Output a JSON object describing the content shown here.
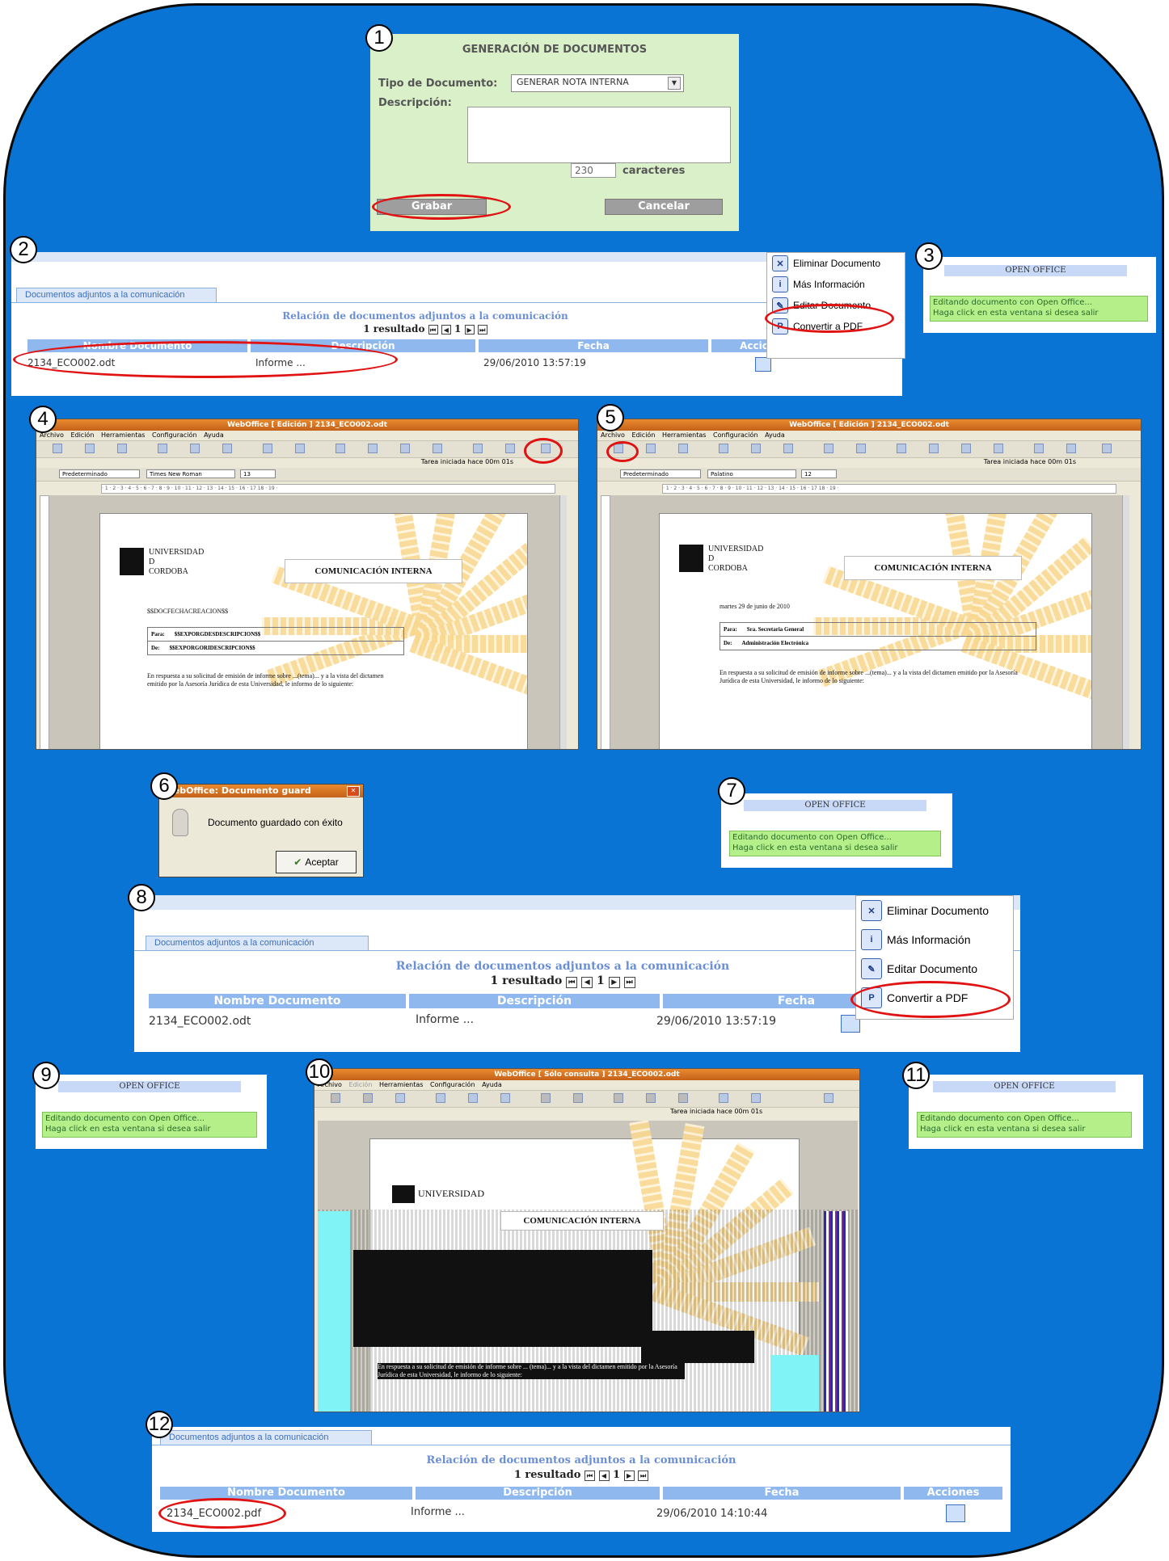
{
  "steps": [
    "1",
    "2",
    "3",
    "4",
    "5",
    "6",
    "7",
    "8",
    "9",
    "10",
    "11",
    "12"
  ],
  "generation": {
    "title": "GENERACIÓN DE DOCUMENTOS",
    "tipo_label": "Tipo de Documento:",
    "tipo_value": "GENERAR NOTA INTERNA",
    "desc_label": "Descripción:",
    "count": "230",
    "count_label": "caracteres",
    "save": "Grabar",
    "cancel": "Cancelar"
  },
  "doclist": {
    "tab": "Documentos adjuntos a la comunicación",
    "title": "Relación de documentos adjuntos a la comunicación",
    "results": "1 resultado",
    "page": "1",
    "columns": [
      "Nombre Documento",
      "Descripción",
      "Fecha",
      "Acciones"
    ],
    "rows": [
      {
        "name": "2134_ECO002.odt",
        "desc": "Informe ...",
        "date": "29/06/2010 13:57:19"
      }
    ],
    "final_row": {
      "name": "2134_ECO002.pdf",
      "desc": "Informe ...",
      "date": "29/06/2010 14:10:44"
    }
  },
  "context_menu": {
    "items": [
      {
        "label": "Eliminar Documento",
        "icon": "x-icon"
      },
      {
        "label": "Más Información",
        "icon": "info-icon"
      },
      {
        "label": "Editar Documento",
        "icon": "edit-icon"
      },
      {
        "label": "Convertir a PDF",
        "icon": "pdf-icon"
      }
    ]
  },
  "open_office": {
    "title": "OPEN OFFICE",
    "line1": "Editando documento con Open Office...",
    "line2": "Haga click en esta ventana si desea salir"
  },
  "weboffice": {
    "title_edit": "WebOffice [ Edición ] 2134_ECO002.odt",
    "title_view": "WebOffice [ Sólo consulta ] 2134_ECO002.odt",
    "menu": [
      "Archivo",
      "Edición",
      "Herramientas",
      "Configuración",
      "Ayuda"
    ],
    "task": "Tarea iniciada hace 00m 01s",
    "style": "Predeterminado",
    "font_a": "Times New Roman",
    "font_b": "Palatino",
    "size_a": "13",
    "size_b": "12",
    "ruler": "· 1 · 2 · 3 · 4 · 5 · 6 · 7 · 8 · 9 · 10 · 11 · 12 · 13 · 14 · 15 · 16 · 17 18 · 19 ·",
    "logo_text": "UNIVERSIDAD\nD\nCORDOBA",
    "heading": "COMUNICACIÓN INTERNA",
    "date_placeholder": "$$DOCFECHACREACION$$",
    "date_value": "martes 29 de junio de 2010",
    "para_label": "Para:",
    "de_label": "De:",
    "para_placeholder": "$$EXPORGDESDESCRIPCION$$",
    "de_placeholder": "$$EXPORGORIDESCRIPCION$$",
    "para_value": "Sra. Secretaria General",
    "de_value": "Administración Electrónica",
    "body": "En respuesta a su solicitud de emisión de informe sobre ...(tema)... y a la vista del dictamen emitido por la Asesoría Jurídica de esta Universidad, le informo de lo siguiente:",
    "view_logo": "UNIVERSIDAD",
    "view_heading": "COMUNICACIÓN INTERNA",
    "view_task": "Tarea iniciada hace 00m 01s",
    "view_body": "En respuesta a su solicitud de emisión de informe sobre ... (tema)... y a la vista del dictamen emitido por la Asesoría Jurídica de esta Universidad, le informo de lo siguiente:"
  },
  "dialog": {
    "title": "WebOffice: Documento guard",
    "message": "Documento guardado con éxito",
    "button": "Aceptar"
  },
  "colors": {
    "background": "#0a74d4",
    "accent_red": "#e11212",
    "green_panel": "#d9f0c9",
    "oo_green": "#b5ef8a"
  }
}
